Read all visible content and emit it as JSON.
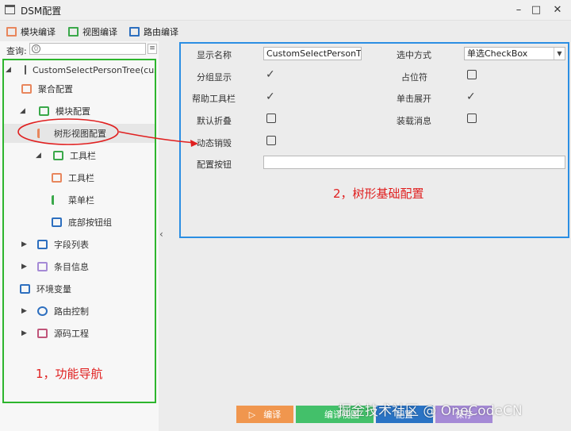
{
  "window": {
    "title": "DSM配置",
    "minimize": "–",
    "maximize": "□",
    "close": "✕"
  },
  "toolbar": {
    "items": [
      {
        "label": "模块编译",
        "color": "#e8865c"
      },
      {
        "label": "视图编译",
        "color": "#3aa84a"
      },
      {
        "label": "路由编译",
        "color": "#2d6fbf"
      }
    ]
  },
  "search": {
    "label": "查询:",
    "value": ""
  },
  "tree": [
    {
      "label": "CustomSelectPersonTree(custom",
      "expanded": true
    },
    {
      "label": "聚合配置"
    },
    {
      "label": "模块配置",
      "expanded": true
    },
    {
      "label": "树形视图配置",
      "selected": true
    },
    {
      "label": "工具栏",
      "expanded": true
    },
    {
      "label": "工具栏"
    },
    {
      "label": "菜单栏"
    },
    {
      "label": "底部按钮组"
    },
    {
      "label": "字段列表",
      "expanded": false
    },
    {
      "label": "条目信息",
      "expanded": false
    },
    {
      "label": "环境变量"
    },
    {
      "label": "路由控制",
      "expanded": false
    },
    {
      "label": "源码工程",
      "expanded": false
    }
  ],
  "form": {
    "display_name": {
      "label": "显示名称",
      "value": "CustomSelectPersonTree"
    },
    "selection_mode": {
      "label": "选中方式",
      "value": "单选CheckBox"
    },
    "group_display": {
      "label": "分组显示",
      "checked": true
    },
    "placeholder": {
      "label": "占位符",
      "checked": false
    },
    "help_toolbar": {
      "label": "帮助工具栏",
      "checked": true
    },
    "click_expand": {
      "label": "单击展开",
      "checked": true
    },
    "default_collapse": {
      "label": "默认折叠",
      "checked": false
    },
    "load_message": {
      "label": "装载消息",
      "checked": false
    },
    "dynamic_destroy": {
      "label": "动态销毁",
      "checked": false
    },
    "config_buttons": {
      "label": "配置按钮",
      "value": ""
    }
  },
  "annotations": {
    "nav_caption": "1，功能导航",
    "config_caption": "2，树形基础配置",
    "nav_color": "#2db52d",
    "config_color": "#2b8ee3",
    "arrow_color": "#e02020"
  },
  "bottom_buttons": [
    {
      "label": "编译",
      "icon": "▷",
      "color": "#f0964e"
    },
    {
      "label": "编译视图",
      "color": "#43c06a"
    },
    {
      "label": "配置",
      "color": "#2a73c4"
    },
    {
      "label": "保存",
      "color": "#a58ad6"
    }
  ],
  "watermark": "掘金技术社区 @ OneCodeCN"
}
